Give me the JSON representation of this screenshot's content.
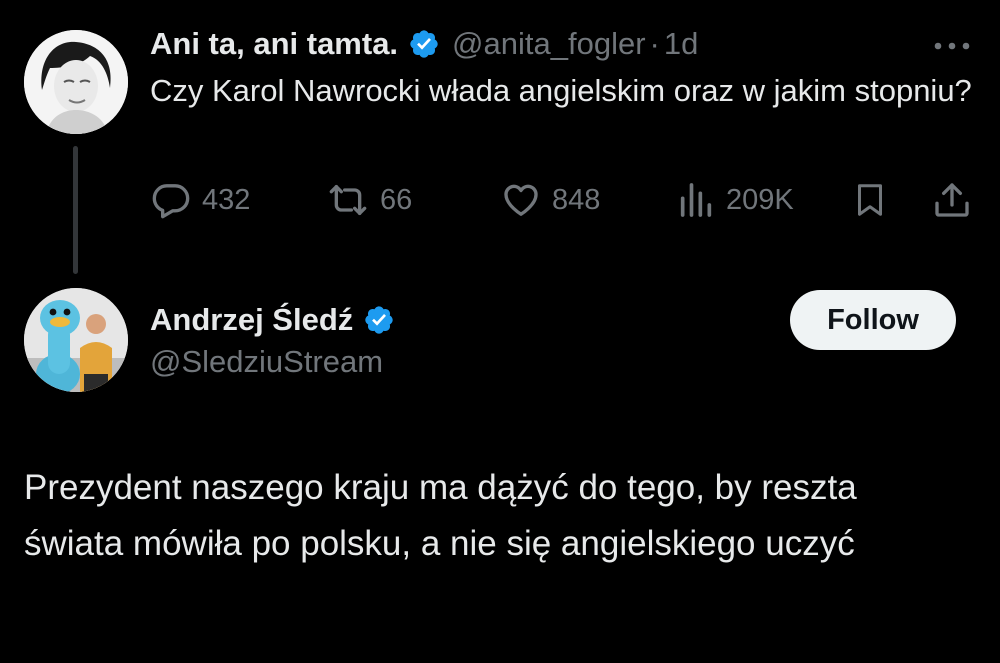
{
  "parent_tweet": {
    "author_name": "Ani ta, ani tamta.",
    "handle": "@anita_fogler",
    "separator": "·",
    "time": "1d",
    "text": "Czy Karol Nawrocki włada angielskim oraz w jakim stopniu?",
    "stats": {
      "replies": "432",
      "reposts": "66",
      "likes": "848",
      "views": "209K"
    },
    "icons": [
      "more-icon",
      "reply-icon",
      "repost-icon",
      "like-icon",
      "views-icon",
      "bookmark-icon",
      "share-icon"
    ]
  },
  "reply_tweet": {
    "author_name": "Andrzej Śledź",
    "handle": "@SledziuStream",
    "follow_label": "Follow",
    "text": "Prezydent naszego kraju ma dążyć do tego, by reszta świata mówiła po polsku, a nie się angielskiego uczyć"
  },
  "colors": {
    "background": "#000000",
    "primary_text": "#e7e9ea",
    "secondary_text": "#71767b",
    "verified_blue": "#1d9bf0",
    "follow_button_bg": "#eff3f4",
    "follow_button_text": "#0f1419",
    "thread_line": "#333639"
  }
}
